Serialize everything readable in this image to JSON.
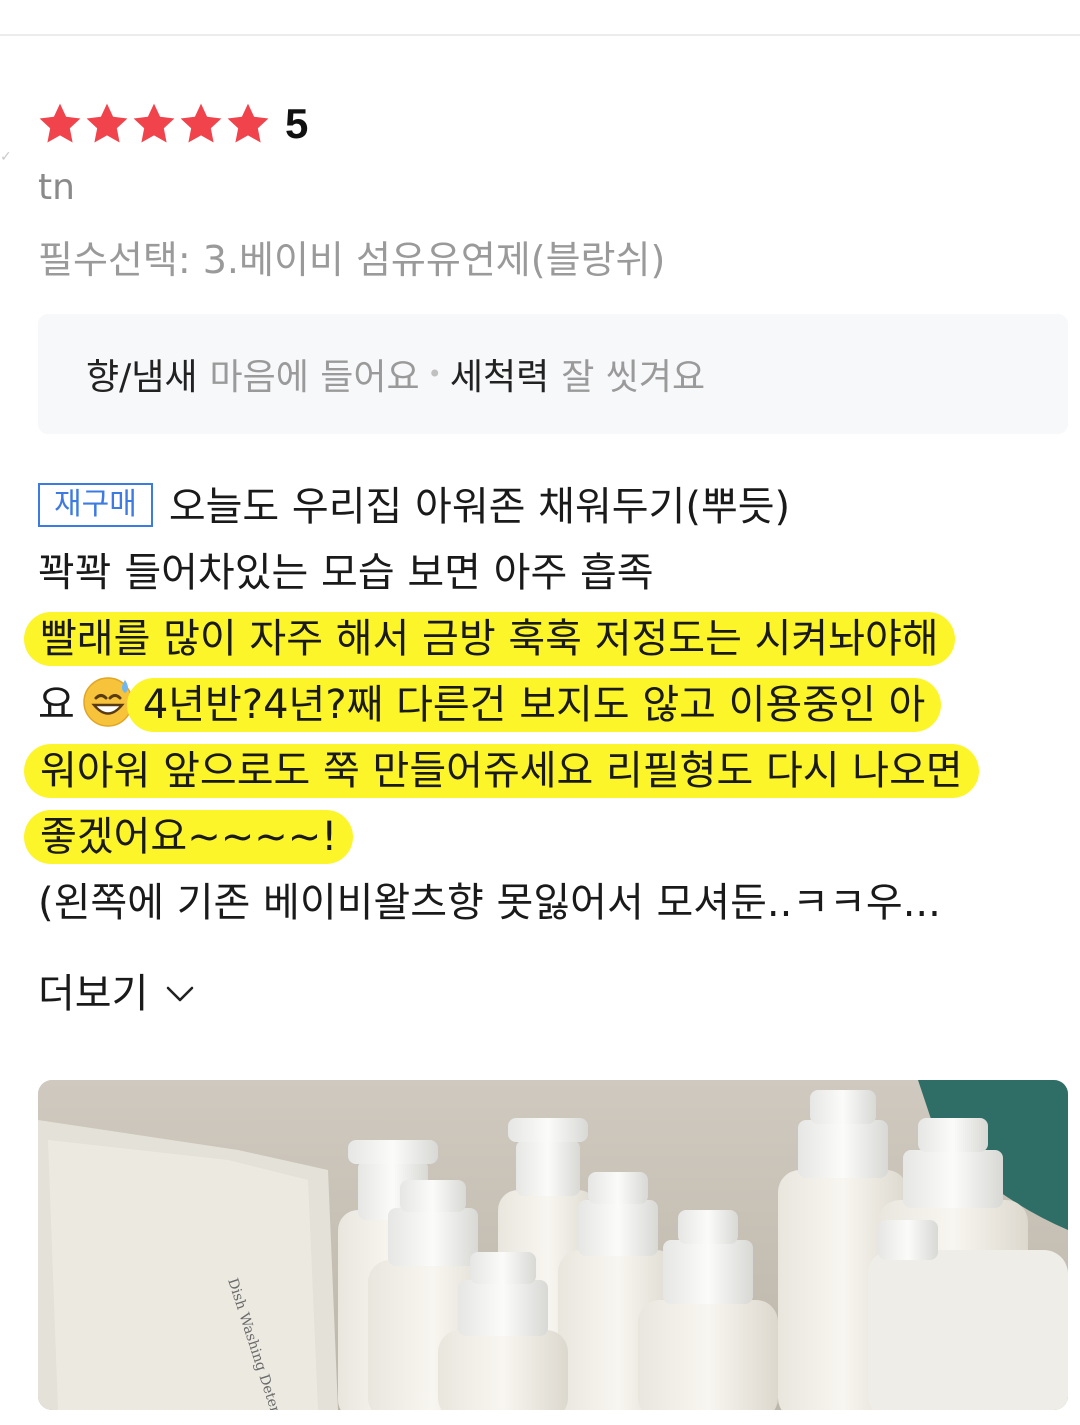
{
  "rating": {
    "stars_filled": 5,
    "stars_total": 5,
    "value_label": "5",
    "star_color": "#f0434b"
  },
  "reviewer": {
    "name": "tn"
  },
  "option": {
    "text": "필수선택: 3.베이비 섬유유연제(블랑쉬)"
  },
  "attributes": [
    {
      "name": "향/냄새",
      "value": "마음에 들어요"
    },
    {
      "name": "세척력",
      "value": "잘 씻겨요"
    }
  ],
  "review": {
    "badge": "재구매",
    "lines": {
      "l1": "오늘도 우리집 아워존 채워두기(뿌듯)",
      "l2": "꽉꽉 들어차있는 모습 보면 아주 흡족",
      "l3": "빨래를 많이 자주 해서 금방 훅훅 저정도는 시켜놔야해",
      "l4a": "요",
      "l4b": "4년반?4년?째 다른건 보지도 않고 이용중인 아",
      "l5": "워아워 앞으로도 쭉 만들어쥬세요 리필형도 다시 나오면",
      "l6": "좋겠어요~~~~!",
      "l7": "(왼쪽에 기존 베이비왈츠향 못잃어서 모셔둔..ㅋㅋ우..."
    },
    "highlight_color": "#fbf52a",
    "emoji": "sweat-smile-emoji"
  },
  "more": {
    "label": "더보기",
    "icon": "chevron-down-icon"
  },
  "photo": {
    "pouch_text": "Dish Washing Detergent"
  },
  "colors": {
    "badge_blue": "#3d7be0"
  }
}
